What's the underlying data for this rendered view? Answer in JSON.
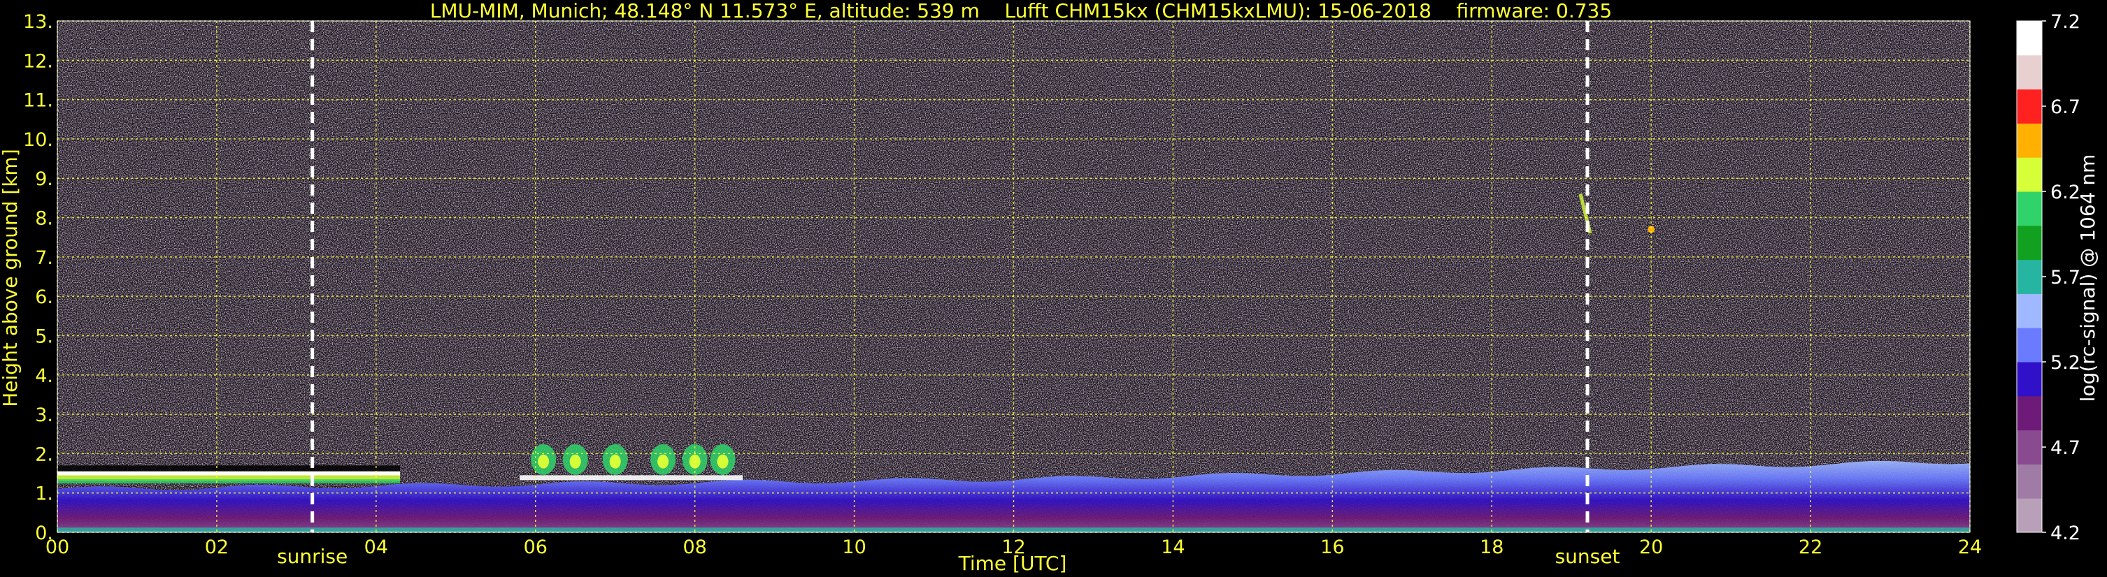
{
  "title": "LMU-MIM, Munich; 48.148° N 11.573° E, altitude: 539 m    Lufft CHM15kx (CHM15kxLMU): 15-06-2018    firmware: 0.735",
  "chart_data": {
    "type": "heatmap",
    "title": "LMU-MIM, Munich; 48.148° N 11.573° E, altitude: 539 m    Lufft CHM15kx (CHM15kxLMU): 15-06-2018    firmware: 0.735",
    "xlabel": "Time [UTC]",
    "ylabel": "Height above ground [km]",
    "xlim": [
      0,
      24
    ],
    "ylim": [
      0,
      13
    ],
    "x_ticks": [
      "00",
      "02",
      "04",
      "06",
      "08",
      "10",
      "12",
      "14",
      "16",
      "18",
      "20",
      "22",
      "24"
    ],
    "x_tick_values": [
      0,
      2,
      4,
      6,
      8,
      10,
      12,
      14,
      16,
      18,
      20,
      22,
      24
    ],
    "y_ticks": [
      "0.",
      "1.",
      "2.",
      "3.",
      "4.",
      "5.",
      "6.",
      "7.",
      "8.",
      "9.",
      "10.",
      "11.",
      "12.",
      "13."
    ],
    "y_tick_values": [
      0,
      1,
      2,
      3,
      4,
      5,
      6,
      7,
      8,
      9,
      10,
      11,
      12,
      13
    ],
    "grid": true,
    "annotations": [
      {
        "label": "sunrise",
        "x": 3.2
      },
      {
        "label": "sunset",
        "x": 19.2
      }
    ],
    "colorbar": {
      "label": "log(rc-signal) @ 1064 nm",
      "ticks": [
        "4.2",
        "4.7",
        "5.2",
        "5.7",
        "6.2",
        "6.7",
        "7.2"
      ],
      "tick_values": [
        4.2,
        4.7,
        5.2,
        5.7,
        6.2,
        6.7,
        7.2
      ],
      "range": [
        4.2,
        7.2
      ],
      "colors": [
        "#b8a0b8",
        "#a07ba5",
        "#8a4a90",
        "#6e1a78",
        "#3010c8",
        "#6b7bff",
        "#9fb8ff",
        "#26b5a0",
        "#11a020",
        "#2fd36a",
        "#d6ff38",
        "#ffb000",
        "#ff2020",
        "#e8d0d0",
        "#ffffff"
      ]
    },
    "features": [
      {
        "name": "boundary layer aerosol",
        "x_range": [
          0,
          24
        ],
        "height_km": [
          0,
          1.9
        ]
      },
      {
        "name": "residual layer top",
        "x_range": [
          0,
          4.3
        ],
        "height_km": [
          1.35,
          1.7
        ]
      },
      {
        "name": "cumulus clouds",
        "x_range": [
          5.8,
          8.6
        ],
        "height_km": [
          1.4,
          2.3
        ]
      },
      {
        "name": "high cloud traces",
        "x": 19.2,
        "height_km": [
          7.6,
          8.6
        ]
      }
    ]
  },
  "axis": {
    "xlabel": "Time [UTC]",
    "ylabel": "Height above ground [km]",
    "sunrise": "sunrise",
    "sunset": "sunset"
  }
}
